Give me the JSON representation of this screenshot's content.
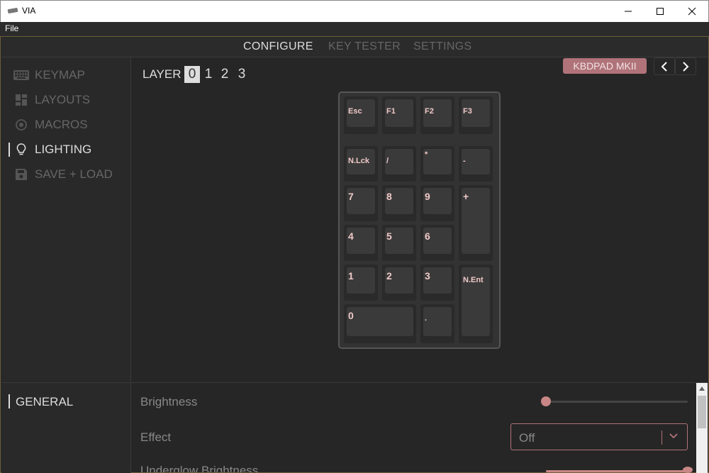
{
  "window": {
    "title": "VIA"
  },
  "menu": {
    "file": "File"
  },
  "tabs": [
    {
      "label": "CONFIGURE",
      "active": true
    },
    {
      "label": "KEY TESTER",
      "active": false
    },
    {
      "label": "SETTINGS",
      "active": false
    }
  ],
  "sidebar": {
    "items": [
      {
        "label": "KEYMAP",
        "icon": "keyboard-icon",
        "active": false
      },
      {
        "label": "LAYOUTS",
        "icon": "layout-grid-icon",
        "active": false
      },
      {
        "label": "MACROS",
        "icon": "record-icon",
        "active": false
      },
      {
        "label": "LIGHTING",
        "icon": "lightbulb-icon",
        "active": true
      },
      {
        "label": "SAVE + LOAD",
        "icon": "floppy-disk-icon",
        "active": false
      }
    ]
  },
  "layers": {
    "label": "LAYER",
    "items": [
      "0",
      "1",
      "2",
      "3"
    ],
    "selected": "0"
  },
  "keyboard": {
    "name": "KBDPAD MKII",
    "keys": [
      "Esc",
      "F1",
      "F2",
      "F3",
      "N.Lck",
      "/",
      "*",
      "-",
      "7",
      "8",
      "9",
      "+",
      "4",
      "5",
      "6",
      "1",
      "2",
      "3",
      "N.Ent",
      "0",
      "."
    ]
  },
  "lighting": {
    "section": "GENERAL",
    "brightness": {
      "label": "Brightness",
      "value": 0
    },
    "effect": {
      "label": "Effect",
      "value": "Off"
    },
    "underglow": {
      "label": "Underglow Brightness"
    }
  },
  "colors": {
    "accent": "#b0737a",
    "legend": "#f0c8c8",
    "background": "#262626"
  }
}
